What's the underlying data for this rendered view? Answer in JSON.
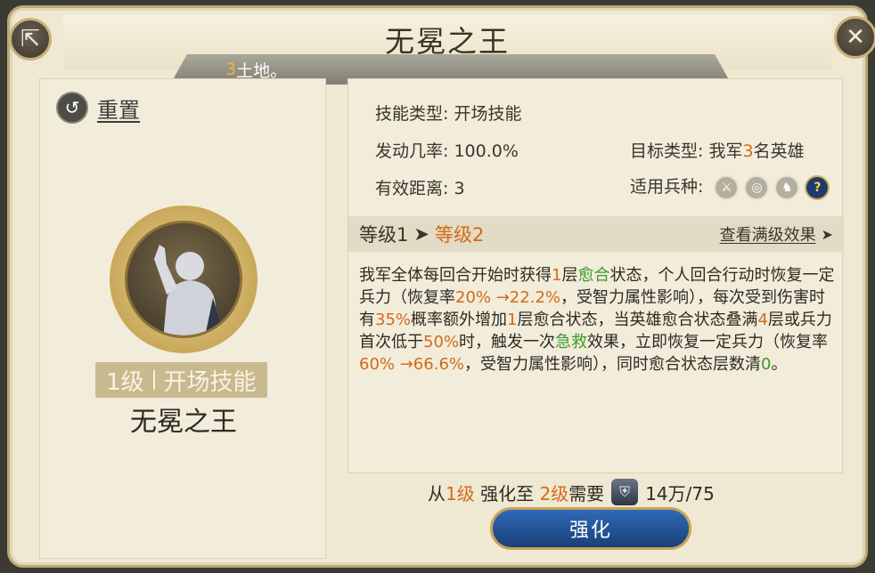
{
  "header": {
    "title": "无冕之王",
    "subbanner_prefix": "3",
    "subbanner_text": "土地。"
  },
  "buttons": {
    "share_icon": "share-icon",
    "close_icon": "close-icon"
  },
  "left": {
    "reset_label": "重置",
    "level_text": "1级",
    "skill_type_tag": "开场技能",
    "skill_name": "无冕之王"
  },
  "right": {
    "skill_type_label": "技能类型:",
    "skill_type_value": "开场技能",
    "trigger_rate_label": "发动几率:",
    "trigger_rate_value": "100.0%",
    "target_type_label": "目标类型:",
    "target_type_pre": "我军",
    "target_type_num": "3",
    "target_type_post": "名英雄",
    "range_label": "有效距离:",
    "range_value": "3",
    "troop_label": "适用兵种:",
    "troop_icons": [
      "sword-icon",
      "target-icon",
      "horse-icon",
      "question-icon"
    ],
    "level_from": "等级1",
    "level_to": "等级2",
    "view_full": "查看满级效果",
    "description": {
      "p1": "我军全体每回合开始时获得",
      "n1": "1",
      "p2": "层",
      "g1": "愈合",
      "p3": "状态，个人回合行动时恢复一定兵力（恢复率",
      "n2": "20% →22.2%",
      "p4": "，受智力属性影响），每次受到伤害时有",
      "n3": "35%",
      "p5": "概率额外增加",
      "n4": "1",
      "p6": "层愈合状态，当英雄愈合状态叠满",
      "n5": "4",
      "p7": "层或兵力首次低于",
      "n6": "50%",
      "p8": "时，触发一次",
      "g2": "急救",
      "p9": "效果，立即恢复一定兵力（恢复率",
      "n7": "60% →66.6%",
      "p10": "，受智力属性影响），同时愈合状态层数清",
      "n8": "0",
      "p11": "。"
    }
  },
  "upgrade": {
    "from_pre": "从",
    "from_lv": "1级",
    "mid": "强化至",
    "to_lv": "2级",
    "need": "需要",
    "cost": "14万/75",
    "button_label": "强化"
  }
}
